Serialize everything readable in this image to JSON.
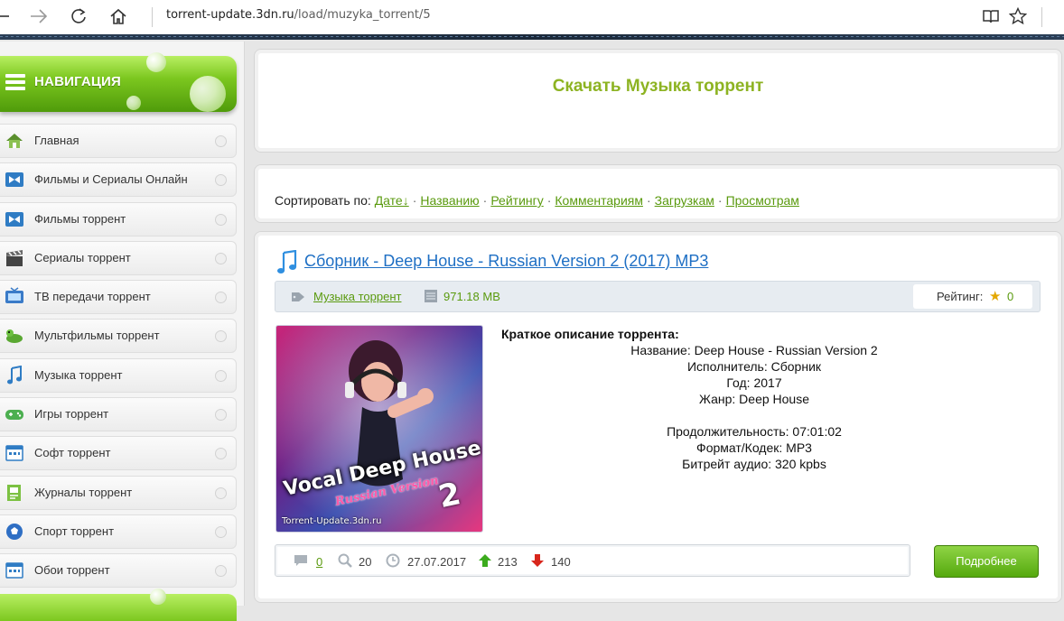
{
  "browser": {
    "url_domain": "torrent-update.3dn.ru",
    "url_path": "/load/muzyka_torrent/5"
  },
  "sidebar": {
    "nav_title": "НАВИГАЦИЯ",
    "items": [
      {
        "label": "Главная",
        "icon": "home-icon"
      },
      {
        "label": "Фильмы и Сериалы Онлайн",
        "icon": "film-icon"
      },
      {
        "label": "Фильмы торрент",
        "icon": "film-icon"
      },
      {
        "label": "Сериалы торрент",
        "icon": "clapper-icon"
      },
      {
        "label": "ТВ передачи торрент",
        "icon": "tv-icon"
      },
      {
        "label": "Мультфильмы торрент",
        "icon": "cartoon-icon"
      },
      {
        "label": "Музыка торрент",
        "icon": "music-note-icon"
      },
      {
        "label": "Игры торрент",
        "icon": "gamepad-icon"
      },
      {
        "label": "Софт торрент",
        "icon": "software-icon"
      },
      {
        "label": "Журналы торрент",
        "icon": "magazine-icon"
      },
      {
        "label": "Спорт торрент",
        "icon": "ball-icon"
      },
      {
        "label": "Обои торрент",
        "icon": "wallpaper-icon"
      }
    ]
  },
  "main": {
    "page_title": "Скачать Музыка торрент",
    "sort": {
      "label": "Сортировать по:",
      "options": [
        "Дате↓",
        "Названию",
        "Рейтингу",
        "Комментариям",
        "Загрузкам",
        "Просмотрам"
      ]
    },
    "entry": {
      "title": "Сборник - Deep House - Russian Version 2 (2017) MP3",
      "category": "Музыка торрент",
      "size": "971.18 MB",
      "rating_label": "Рейтинг:",
      "rating_value": "0",
      "cover": {
        "line1": "Vocal Deep House",
        "line2": "Russian Version",
        "number": "2",
        "watermark": "Torrent-Update.3dn.ru"
      },
      "description_heading": "Краткое описание торрента:",
      "description_lines": [
        "Название: Deep House - Russian Version 2",
        "Исполнитель: Сборник",
        "Год: 2017",
        "Жанр: Deep House",
        "",
        "Продолжительность: 07:01:02",
        "Формат/Кодек: MP3",
        "Битрейт аудио: 320 kpbs"
      ],
      "comments": "0",
      "views": "20",
      "date": "27.07.2017",
      "up": "213",
      "down": "140",
      "more_button": "Подробнее"
    }
  }
}
